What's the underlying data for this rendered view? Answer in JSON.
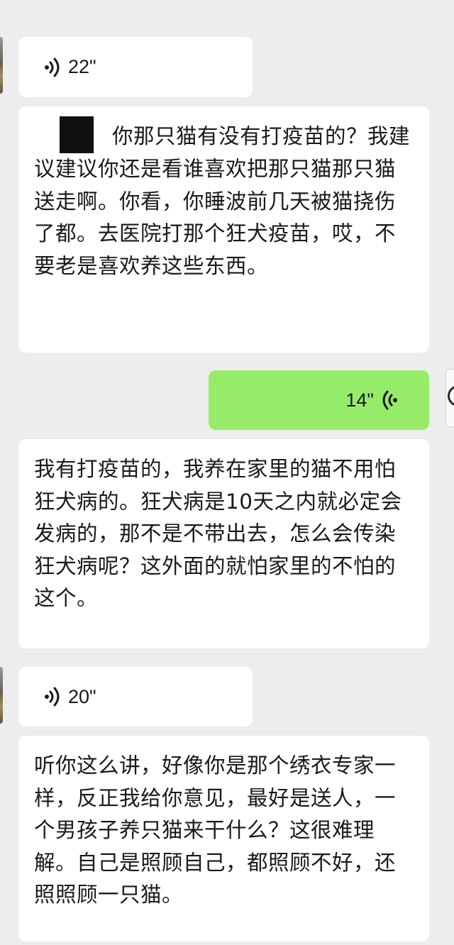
{
  "messages": [
    {
      "type": "voice",
      "side": "left",
      "duration": "22\""
    },
    {
      "type": "text",
      "side": "left",
      "text": "你那只猫有没有打疫苗的？我建议建议你还是看谁喜欢把那只猫那只猫送走啊。你看，你睡波前几天被猫挠伤了都。去医院打那个狂犬疫苗，哎，不要老是喜欢养这些东西。"
    },
    {
      "type": "voice",
      "side": "right",
      "duration": "14\""
    },
    {
      "type": "text",
      "side": "left",
      "text": "我有打疫苗的，我养在家里的猫不用怕狂犬病的。狂犬病是10天之内就必定会发病的，那不是不带出去，怎么会传染狂犬病呢？这外面的就怕家里的不怕的这个。"
    },
    {
      "type": "voice",
      "side": "left",
      "duration": "20\""
    },
    {
      "type": "text",
      "side": "left",
      "text": "听你这么讲，好像你是那个绣衣专家一样，反正我给你意见，最好是送人，一个男孩子养只猫来干什么？这很难理解。自己是照顾自己，都照顾不好，还照照顾一只猫。"
    }
  ],
  "colors": {
    "background": "#ededed",
    "bubble_other": "#ffffff",
    "bubble_self": "#95ec69",
    "text": "#191919"
  },
  "icons": {
    "voice_left": "voice-wave-icon",
    "voice_right": "voice-wave-icon-mirrored"
  }
}
